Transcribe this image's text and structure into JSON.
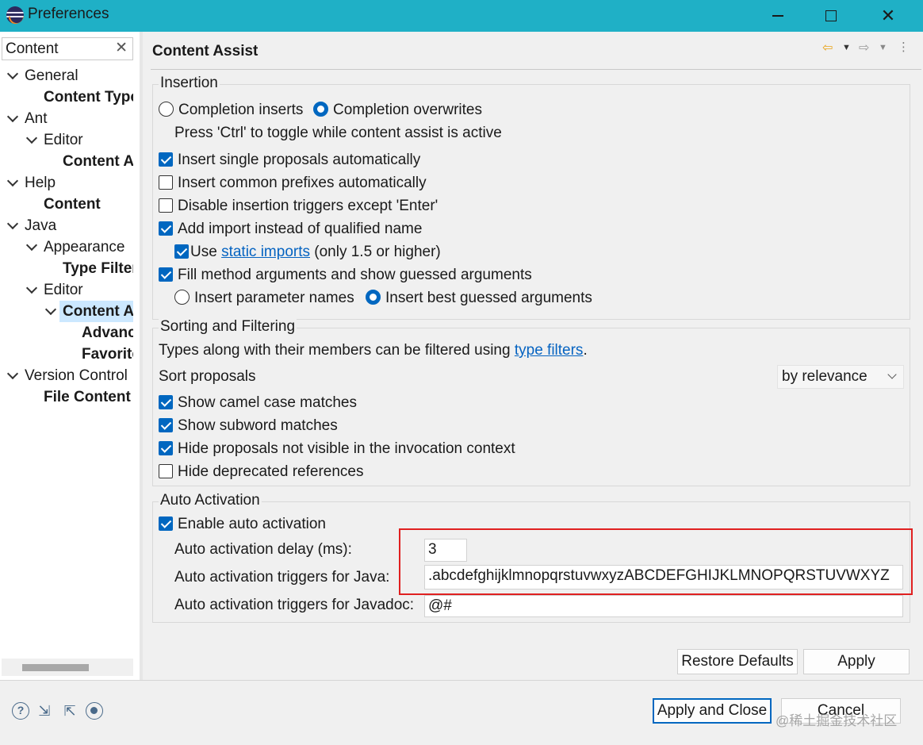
{
  "window": {
    "title": "Preferences",
    "close_glyph": "✕"
  },
  "tree": {
    "filter_value": "Content",
    "clear_glyph": "✕",
    "items": [
      {
        "label": "General"
      },
      {
        "label": "Content Types"
      },
      {
        "label": "Ant"
      },
      {
        "label": "Editor"
      },
      {
        "label": "Content Assist"
      },
      {
        "label": "Help"
      },
      {
        "label": "Content"
      },
      {
        "label": "Java"
      },
      {
        "label": "Appearance"
      },
      {
        "label": "Type Filters"
      },
      {
        "label": "Editor"
      },
      {
        "label": "Content Assist"
      },
      {
        "label": "Advanced"
      },
      {
        "label": "Favorites"
      },
      {
        "label": "Version Control"
      },
      {
        "label": "File Content"
      }
    ]
  },
  "page": {
    "title": "Content Assist",
    "nav": {
      "back": "⇦",
      "forward": "⇨",
      "drop": "▼",
      "menu": "⋮"
    }
  },
  "insertion": {
    "label": "Insertion",
    "completion_inserts": "Completion inserts",
    "completion_overwrites": "Completion overwrites",
    "toggle_hint": "Press 'Ctrl' to toggle while content assist is active",
    "insert_single": "Insert single proposals automatically",
    "insert_common": "Insert common prefixes automatically",
    "disable_triggers": "Disable insertion triggers except 'Enter'",
    "add_import": "Add import instead of qualified name",
    "use_label": "Use",
    "static_imports_link": "static imports",
    "static_suffix": "(only 1.5 or higher)",
    "fill_args": "Fill method arguments and show guessed arguments",
    "insert_param_names": "Insert parameter names",
    "insert_best_guessed": "Insert best guessed arguments"
  },
  "sorting": {
    "label": "Sorting and Filtering",
    "types_text": "Types along with their members can be filtered using",
    "type_filters_link": "type filters",
    "period": ".",
    "sort_label": "Sort proposals",
    "sort_value": "by relevance",
    "camel": "Show camel case matches",
    "subword": "Show subword matches",
    "hide_not_visible": "Hide proposals not visible in the invocation context",
    "hide_deprecated": "Hide deprecated references"
  },
  "auto": {
    "label": "Auto Activation",
    "enable": "Enable auto activation",
    "delay_label": "Auto activation delay (ms):",
    "delay_value": "3",
    "java_label": "Auto activation triggers for Java:",
    "java_value": ".abcdefghijklmnopqrstuvwxyzABCDEFGHIJKLMNOPQRSTUVWXYZ",
    "javadoc_label": "Auto activation triggers for Javadoc:",
    "javadoc_value": "@#"
  },
  "buttons": {
    "restore_defaults": "Restore Defaults",
    "apply": "Apply",
    "apply_close": "Apply and Close",
    "cancel": "Cancel"
  },
  "bottom_icons": {
    "help": "?",
    "import": "⇲",
    "export": "⇱"
  },
  "watermark": "@稀土掘金技术社区",
  "colors": {
    "titlebar": "#1fb0c6",
    "accent": "#0067c0",
    "link": "#0563c1",
    "highlight_box": "#e02020"
  }
}
